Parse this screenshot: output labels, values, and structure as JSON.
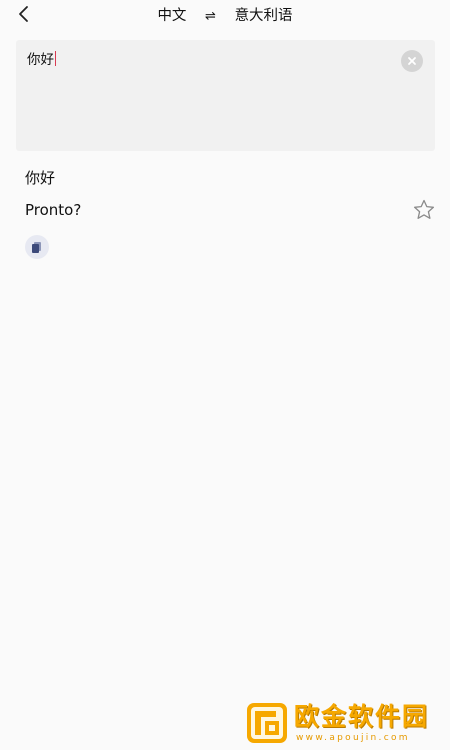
{
  "header": {
    "source_lang": "中文",
    "swap_symbol": "⇌",
    "target_lang": "意大利语"
  },
  "input": {
    "value": "你好"
  },
  "result": {
    "source_text": "你好",
    "translation": "Pronto?"
  },
  "icons": {
    "back": "chevron-left-icon",
    "clear": "close-circle-icon",
    "favorite": "star-outline-icon",
    "copy": "copy-icon"
  },
  "colors": {
    "background": "#fafafa",
    "input_background": "#f1f1f1",
    "caret": "#d83b52",
    "copy_button_bg": "#e7e9f2",
    "copy_icon": "#3d4a7a",
    "watermark": "#f6a800"
  },
  "watermark": {
    "title": "欧金软件园",
    "url": "www.apoujin.com"
  }
}
